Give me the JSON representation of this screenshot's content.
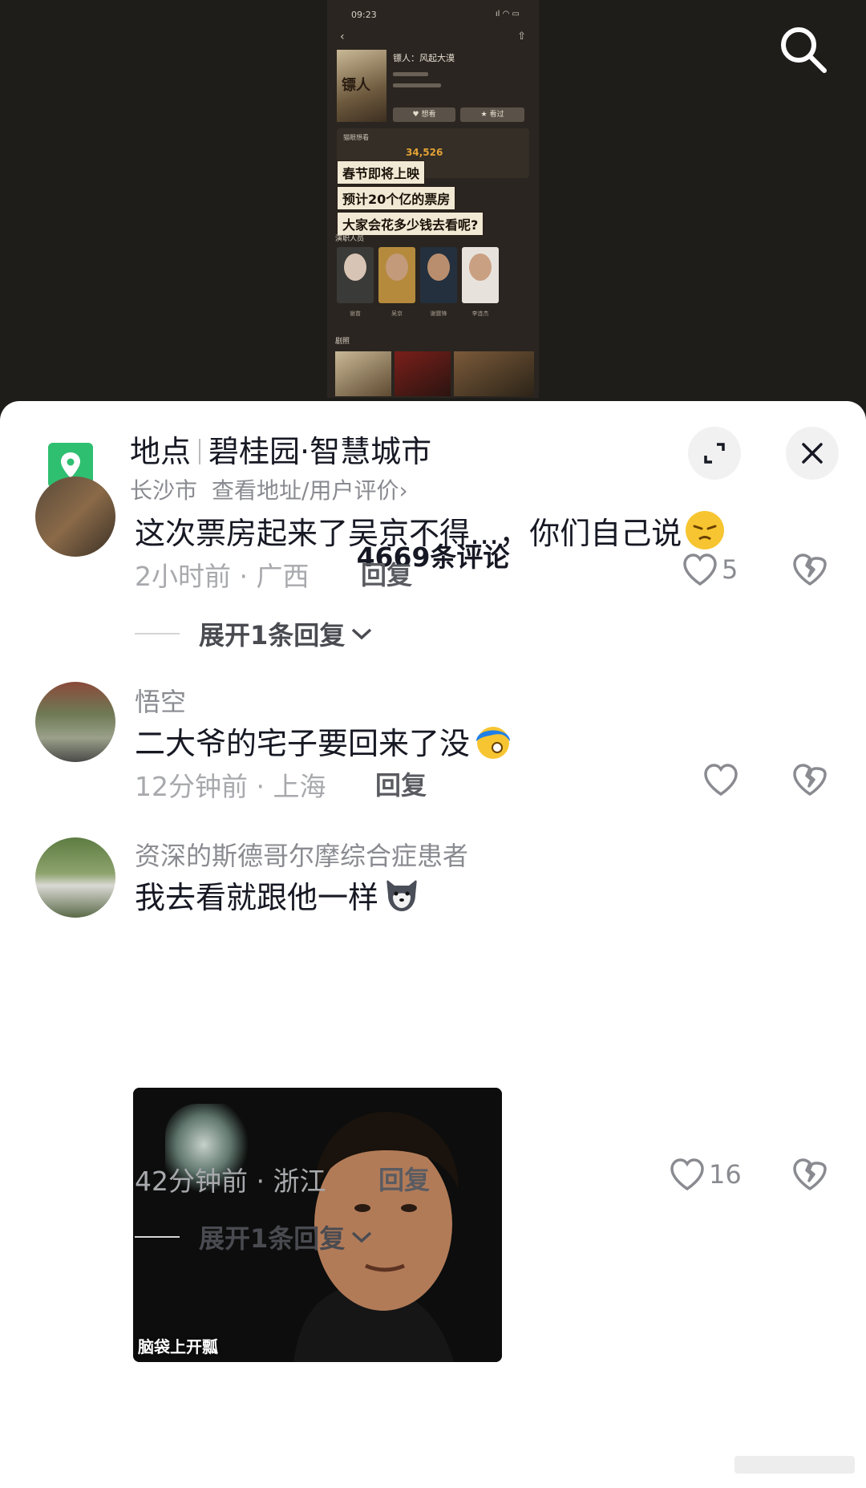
{
  "video": {
    "status_time": "09:23",
    "movie_title": "镖人：风起大漠",
    "rating_label": "猫眼想看",
    "rating_number": "34,526",
    "overlay_lines": [
      "春节即将上映",
      "预计20个亿的票房",
      "大家会花多少钱去看呢?"
    ],
    "section_cast": "演职人员",
    "section_clips": "剧照",
    "btn_want": "想看",
    "btn_seen": "看过",
    "actor_names": [
      "谢苗",
      "吴京",
      "谢霆锋",
      "李连杰"
    ],
    "poster_title": "镖人"
  },
  "poi": {
    "label": "地点",
    "name": "碧桂园·智慧城市",
    "city": "长沙市",
    "detail_link": "查看地址/用户评价",
    "chevron": "›"
  },
  "comments_header": "4669条评论",
  "comments": [
    {
      "text": "这次票房起来了吴京不得...，你们自己说",
      "time": "2小时前",
      "location": "广西",
      "reply_label": "回复",
      "likes": "5",
      "expand_label": "展开1条回复",
      "emoji": "angry-face"
    },
    {
      "username": "悟空",
      "text": "二大爷的宅子要回来了没",
      "time": "12分钟前",
      "location": "上海",
      "reply_label": "回复",
      "likes": "",
      "emoji": "blue-hair-face"
    },
    {
      "username": "资深的斯德哥尔摩综合症患者",
      "text": "我去看就跟他一样",
      "time": "42分钟前",
      "location": "浙江",
      "reply_label": "回复",
      "likes": "16",
      "expand_label": "展开1条回复",
      "meme_caption": "脑袋上开瓢",
      "emoji": "husky-face"
    }
  ],
  "meta_separator": " · ",
  "icons": {
    "search": "search-icon",
    "location": "location-pin-icon",
    "expand": "expand-icon",
    "close": "close-icon",
    "like": "heart-icon",
    "dislike": "broken-heart-icon"
  },
  "colors": {
    "poi_green": "#2fbf71",
    "text_primary": "#161823",
    "text_secondary": "#8a8b91",
    "rating_orange": "#e3a235"
  }
}
